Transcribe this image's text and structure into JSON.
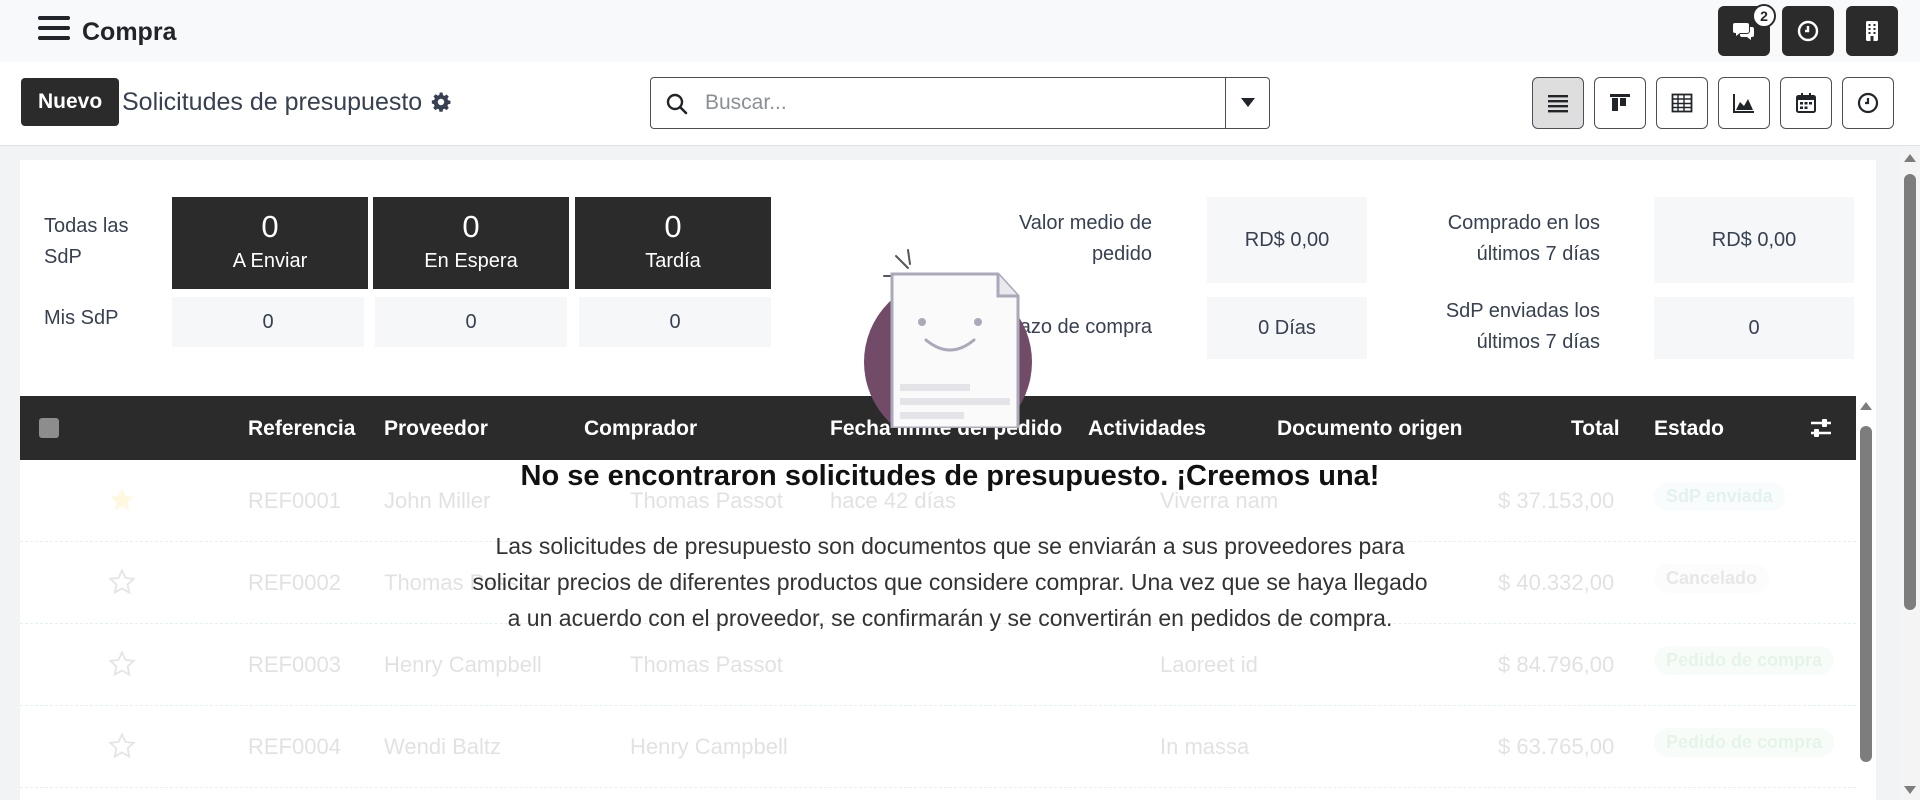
{
  "app": {
    "title": "Compra"
  },
  "systray": {
    "messages_count": "2"
  },
  "control": {
    "new_label": "Nuevo",
    "title": "Solicitudes de presupuesto",
    "search_placeholder": "Buscar..."
  },
  "dashboard": {
    "all_label": "Todas las SdP",
    "mine_label": "Mis SdP",
    "tiles": [
      {
        "count": "0",
        "label": "A Enviar",
        "mine": "0"
      },
      {
        "count": "0",
        "label": "En Espera",
        "mine": "0"
      },
      {
        "count": "0",
        "label": "Tardía",
        "mine": "0"
      }
    ],
    "stats": {
      "avg_order_label": "Valor medio de pedido",
      "avg_order_value": "RD$ 0,00",
      "lead_time_label": "Plazo de compra",
      "lead_time_value": "0 Días",
      "purchased_label": "Comprado en los últimos 7 días",
      "purchased_value": "RD$ 0,00",
      "sent_label": "SdP enviadas los últimos 7 días",
      "sent_value": "0"
    }
  },
  "table": {
    "columns": {
      "reference": "Referencia",
      "vendor": "Proveedor",
      "buyer": "Comprador",
      "deadline": "Fecha límite del pedido",
      "activities": "Actividades",
      "source": "Documento origen",
      "total": "Total",
      "status": "Estado"
    },
    "rows": [
      {
        "ref": "REF0001",
        "vendor": "John Miller",
        "buyer": "Thomas Passot",
        "deadline": "hace 42 días",
        "activity": "Viverra nam",
        "total": "$ 37.153,00",
        "status": "SdP enviada"
      },
      {
        "ref": "REF0002",
        "vendor": "Thomas Passot",
        "buyer": "",
        "deadline": "",
        "activity": "",
        "total": "$ 40.332,00",
        "status": "Cancelado"
      },
      {
        "ref": "REF0003",
        "vendor": "Henry Campbell",
        "buyer": "Thomas Passot",
        "deadline": "",
        "activity": "Laoreet id",
        "total": "$ 84.796,00",
        "status": "Pedido de compra"
      },
      {
        "ref": "REF0004",
        "vendor": "Wendi Baltz",
        "buyer": "Henry Campbell",
        "deadline": "",
        "activity": "In massa",
        "total": "$ 63.765,00",
        "status": "Pedido de compra"
      }
    ]
  },
  "empty_state": {
    "title": "No se encontraron solicitudes de presupuesto. ¡Creemos una!",
    "text": "Las solicitudes de presupuesto son documentos que se enviarán a sus proveedores para solicitar precios de diferentes productos que considere comprar. Una vez que se haya llegado a un acuerdo con el proveedor, se confirmarán y se convertirán en pedidos de compra."
  },
  "colors": {
    "dark": "#2b2b2b",
    "brand": "#714b67",
    "sent": "#1f8f86",
    "done": "#28a745"
  }
}
